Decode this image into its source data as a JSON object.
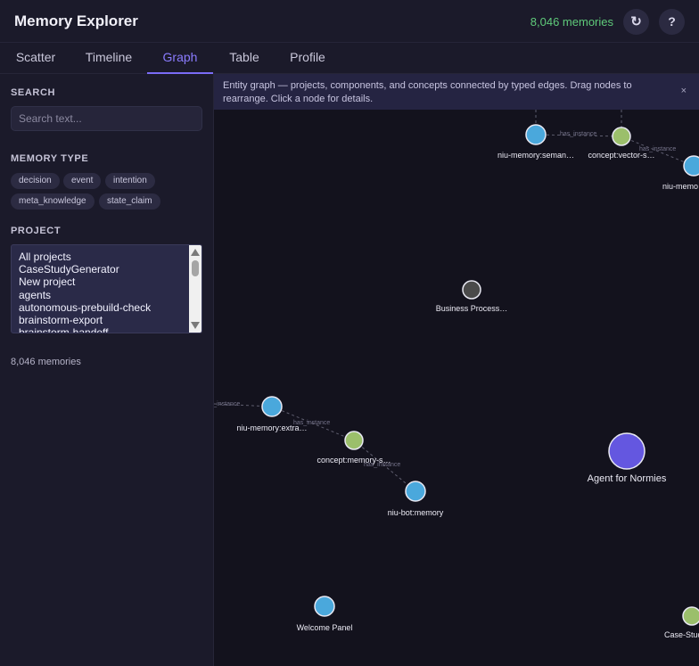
{
  "header": {
    "title": "Memory Explorer",
    "memory_count": "8,046 memories",
    "refresh_icon": "↻",
    "help_icon": "?"
  },
  "tabs": [
    {
      "label": "Scatter"
    },
    {
      "label": "Timeline"
    },
    {
      "label": "Graph",
      "active": true
    },
    {
      "label": "Table"
    },
    {
      "label": "Profile"
    }
  ],
  "sidebar": {
    "search_label": "SEARCH",
    "search_placeholder": "Search text...",
    "memory_type_label": "MEMORY TYPE",
    "memory_types": [
      "decision",
      "event",
      "intention",
      "meta_knowledge",
      "state_claim"
    ],
    "project_label": "PROJECT",
    "projects": [
      "All projects",
      "CaseStudyGenerator",
      "New project",
      "agents",
      "autonomous-prebuild-check",
      "brainstorm-export",
      "brainstorm-handoff"
    ],
    "footer_count": "8,046 memories"
  },
  "banner": {
    "text": "Entity graph — projects, components, and concepts connected by typed edges. Drag nodes to rearrange. Click a node for details.",
    "close_icon": "×"
  },
  "graph": {
    "colors": {
      "component": "#4aa8dc",
      "concept": "#9bbf6b",
      "project": "#6457e0",
      "other": "#4a4a4a",
      "edge": "#5e5d6e"
    },
    "nodes": [
      {
        "id": "n1",
        "label": "niu-memory:seman…",
        "kind": "component"
      },
      {
        "id": "n2",
        "label": "concept:vector-s…",
        "kind": "concept"
      },
      {
        "id": "n3",
        "label": "niu-memo",
        "kind": "component"
      },
      {
        "id": "n4",
        "label": "Business Process…",
        "kind": "other"
      },
      {
        "id": "n5",
        "label": "niu-memory:extra…",
        "kind": "component"
      },
      {
        "id": "n6",
        "label": "concept:memory-s…",
        "kind": "concept"
      },
      {
        "id": "n7",
        "label": "niu-bot:memory",
        "kind": "component"
      },
      {
        "id": "n8",
        "label": "Agent for Normies",
        "kind": "project"
      },
      {
        "id": "n9",
        "label": "Welcome Panel",
        "kind": "component"
      },
      {
        "id": "n10",
        "label": "Case-Stud",
        "kind": "concept"
      }
    ],
    "edges": [
      {
        "from": "n1",
        "to": "n2",
        "label": "has_instance"
      },
      {
        "from": "n2",
        "to": "n3",
        "label": "has_instance"
      },
      {
        "from": "n5",
        "to": "n6",
        "label": "has_instance"
      },
      {
        "from": "n6",
        "to": "n7",
        "label": "has_instance"
      },
      {
        "from": "offscreen-left",
        "to": "n5",
        "label": "has_instance"
      }
    ]
  }
}
